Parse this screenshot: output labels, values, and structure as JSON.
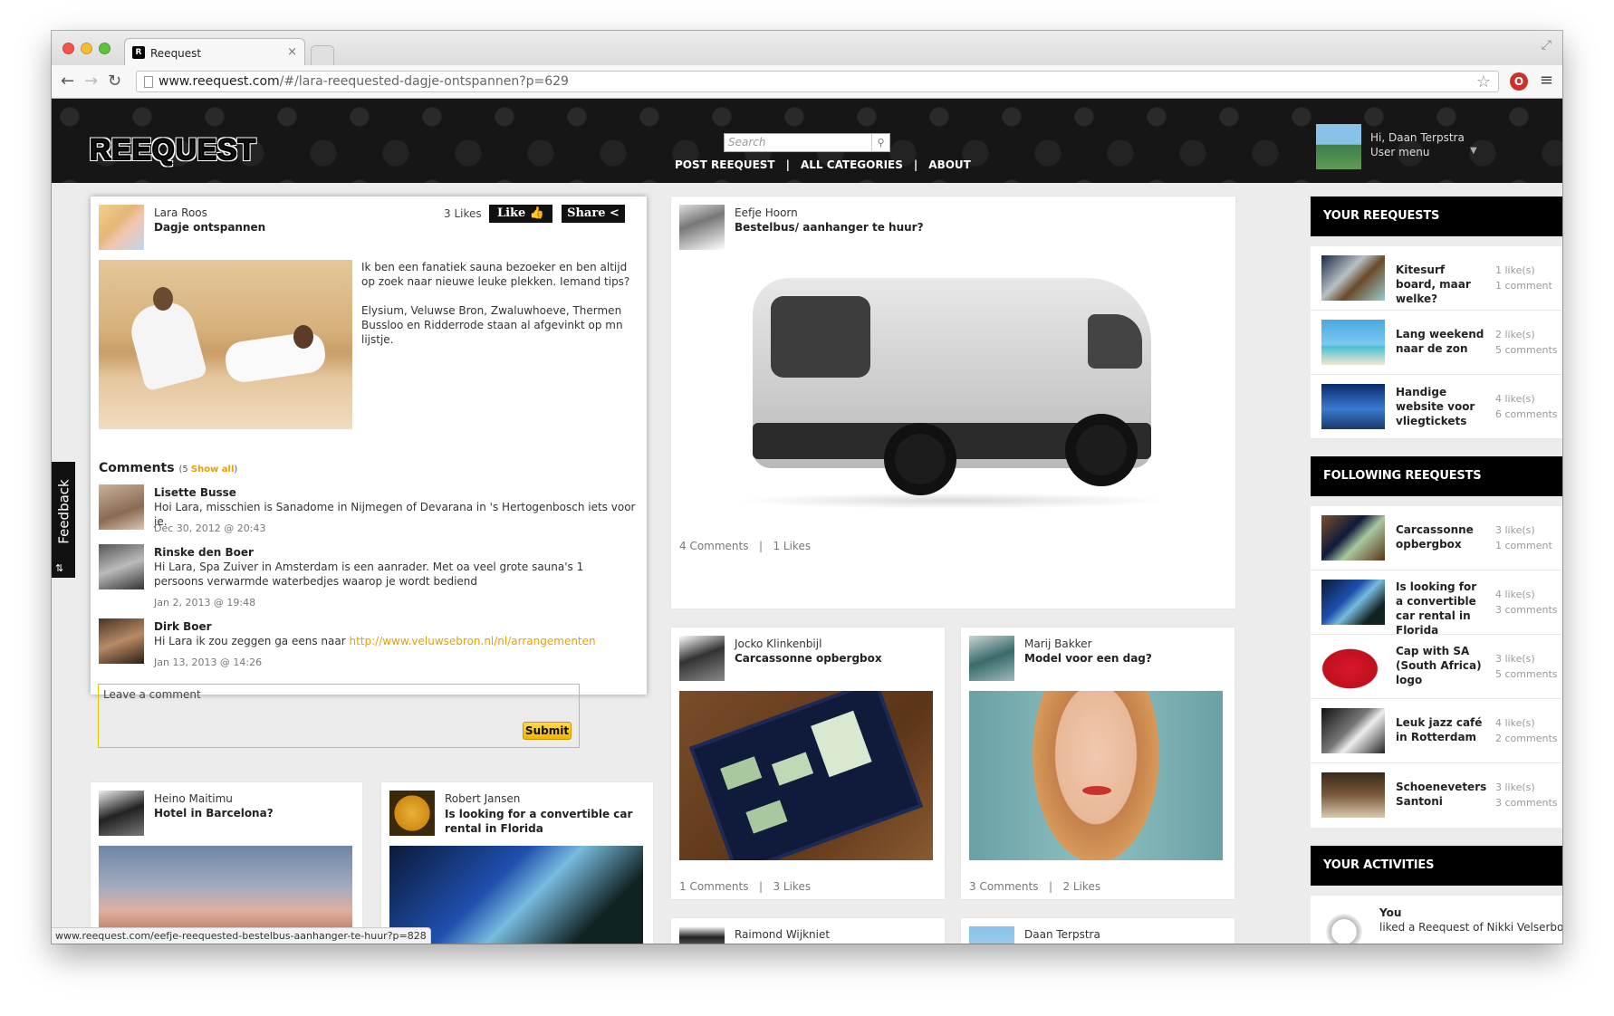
{
  "browser": {
    "tab_title": "Reequest",
    "url_domain": "www.reequest.com",
    "url_path": "/#/lara-reequested-dagje-ontspannen?p=629",
    "status_url": "www.reequest.com/eefje-reequested-bestelbus-aanhanger-te-huur?p=828"
  },
  "header": {
    "logo": "REEQUEST",
    "search_placeholder": "Search",
    "nav": [
      "POST REEQUEST",
      "|",
      "ALL CATEGORIES",
      "|",
      "ABOUT"
    ],
    "user_greeting": "Hi, Daan Terpstra",
    "user_menu": "User menu"
  },
  "feedback": "Feedback",
  "main_post": {
    "author": "Lara Roos",
    "title": "Dagje ontspannen",
    "likes": "3 Likes",
    "like_btn": "Like",
    "share_btn": "Share",
    "text1": "Ik ben een fanatiek sauna bezoeker en ben altijd op zoek naar nieuwe leuke plekken. Iemand tips?",
    "text2": "Elysium, Veluwse Bron, Zwaluwhoeve, Thermen Bussloo en Ridderrode staan al afgevinkt op mn lijstje.",
    "comments_heading": "Comments",
    "comments_count": "(5",
    "show_all": "Show all",
    "comments_close": ")",
    "comments": [
      {
        "name": "Lisette Busse",
        "text": "Hoi Lara, misschien is Sanadome in Nijmegen of Devarana in 's Hertogenbosch iets voor je.",
        "date": "Dec 30, 2012 @ 20:43"
      },
      {
        "name": "Rinske den Boer",
        "text": "Hi Lara, Spa Zuiver in Amsterdam is een aanrader. Met oa veel grote sauna's 1 persoons verwarmde waterbedjes waarop je wordt bediend",
        "date": "Jan 2, 2013 @ 19:48"
      },
      {
        "name": "Dirk Boer",
        "text_pre": "Hi Lara ik zou zeggen ga eens naar ",
        "link": "http://www.veluwsebron.nl/nl/arrangementen",
        "date": "Jan 13, 2013 @ 14:26"
      }
    ],
    "leave_comment": "Leave a comment",
    "submit": "Submit"
  },
  "posts": [
    {
      "author": "Eefje Hoorn",
      "title": "Bestelbus/ aanhanger te huur?",
      "comments": "4 Comments",
      "sep": "|",
      "likes": "1 Likes"
    },
    {
      "author": "Jocko Klinkenbijl",
      "title": "Carcassonne opbergbox",
      "comments": "1 Comments",
      "sep": "|",
      "likes": "3 Likes"
    },
    {
      "author": "Marij Bakker",
      "title": "Model voor een dag?",
      "comments": "3 Comments",
      "sep": "|",
      "likes": "2 Likes"
    },
    {
      "author": "Heino Maitimu",
      "title": "Hotel in Barcelona?"
    },
    {
      "author": "Robert Jansen",
      "title": "Is looking for a convertible car rental in Florida"
    },
    {
      "author": "Raimond Wijkniet"
    },
    {
      "author": "Daan Terpstra"
    }
  ],
  "sidebar": {
    "your_heading": "YOUR REEQUESTS",
    "your": [
      {
        "label": "Kitesurf board, maar welke?",
        "likes": "1 like(s)",
        "comments": "1 comment"
      },
      {
        "label": "Lang weekend naar de zon",
        "likes": "2 like(s)",
        "comments": "5 comments"
      },
      {
        "label": "Handige website voor vliegtickets",
        "likes": "4 like(s)",
        "comments": "6 comments"
      }
    ],
    "following_heading": "FOLLOWING REEQUESTS",
    "following": [
      {
        "label": "Carcassonne opbergbox",
        "likes": "3 like(s)",
        "comments": "1 comment"
      },
      {
        "label": "Is looking for a convertible car rental in Florida",
        "likes": "4 like(s)",
        "comments": "3 comments"
      },
      {
        "label": "Cap with SA (South Africa) logo",
        "likes": "3 like(s)",
        "comments": "5 comments"
      },
      {
        "label": "Leuk jazz café in Rotterdam",
        "likes": "4 like(s)",
        "comments": "2 comments"
      },
      {
        "label": "Schoeneveters Santoni",
        "likes": "3 like(s)",
        "comments": "3 comments"
      }
    ],
    "activities_heading": "YOUR ACTIVITIES",
    "activity_who": "You",
    "activity_text": "liked a Reequest of Nikki Velserbosch"
  }
}
